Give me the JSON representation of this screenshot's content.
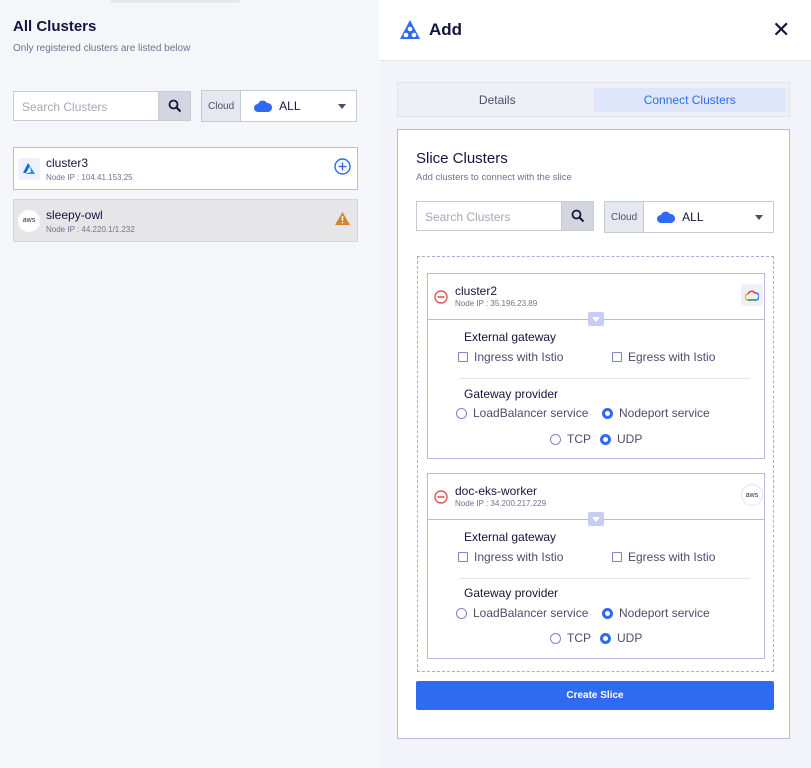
{
  "left": {
    "title": "All Clusters",
    "subtitle": "Only registered clusters are listed below",
    "search": {
      "placeholder": "Search Clusters"
    },
    "cloud": {
      "label": "Cloud",
      "value": "ALL"
    },
    "clusters": [
      {
        "name": "cluster3",
        "ip": "Node IP : 104.41.153.25",
        "provider": "azure-icon",
        "action": "add-circle-icon"
      },
      {
        "name": "sleepy-owl",
        "ip": "Node IP : 44.220.1/1.232",
        "provider": "aws",
        "action": "warning-icon"
      }
    ]
  },
  "right": {
    "title": "Add",
    "close": "✕",
    "tabs": [
      "Details",
      "Connect Clusters"
    ],
    "panel": {
      "title": "Slice Clusters",
      "subtitle": "Add clusters to connect with the slice",
      "search": {
        "placeholder": "Search Clusters"
      },
      "cloud": {
        "label": "Cloud",
        "value": "ALL"
      },
      "cards": [
        {
          "name": "cluster2",
          "ip": "Node IP : 35.196.23.89",
          "provider": "gcp-icon",
          "external_gateway": "External gateway",
          "ingress": "Ingress with Istio",
          "egress": "Egress with Istio",
          "gateway_provider": "Gateway provider",
          "lb": "LoadBalancer service",
          "nodeport": "Nodeport service",
          "tcp": "TCP",
          "udp": "UDP"
        },
        {
          "name": "doc-eks-worker",
          "ip": "Node IP : 34.200.217.229",
          "provider": "aws",
          "external_gateway": "External gateway",
          "ingress": "Ingress with Istio",
          "egress": "Egress with Istio",
          "gateway_provider": "Gateway provider",
          "lb": "LoadBalancer service",
          "nodeport": "Nodeport service",
          "tcp": "TCP",
          "udp": "UDP"
        }
      ],
      "create_button": "Create Slice"
    }
  },
  "colors": {
    "accent": "#2e6bf0",
    "danger": "#e05656",
    "warning": "#d9822b"
  }
}
